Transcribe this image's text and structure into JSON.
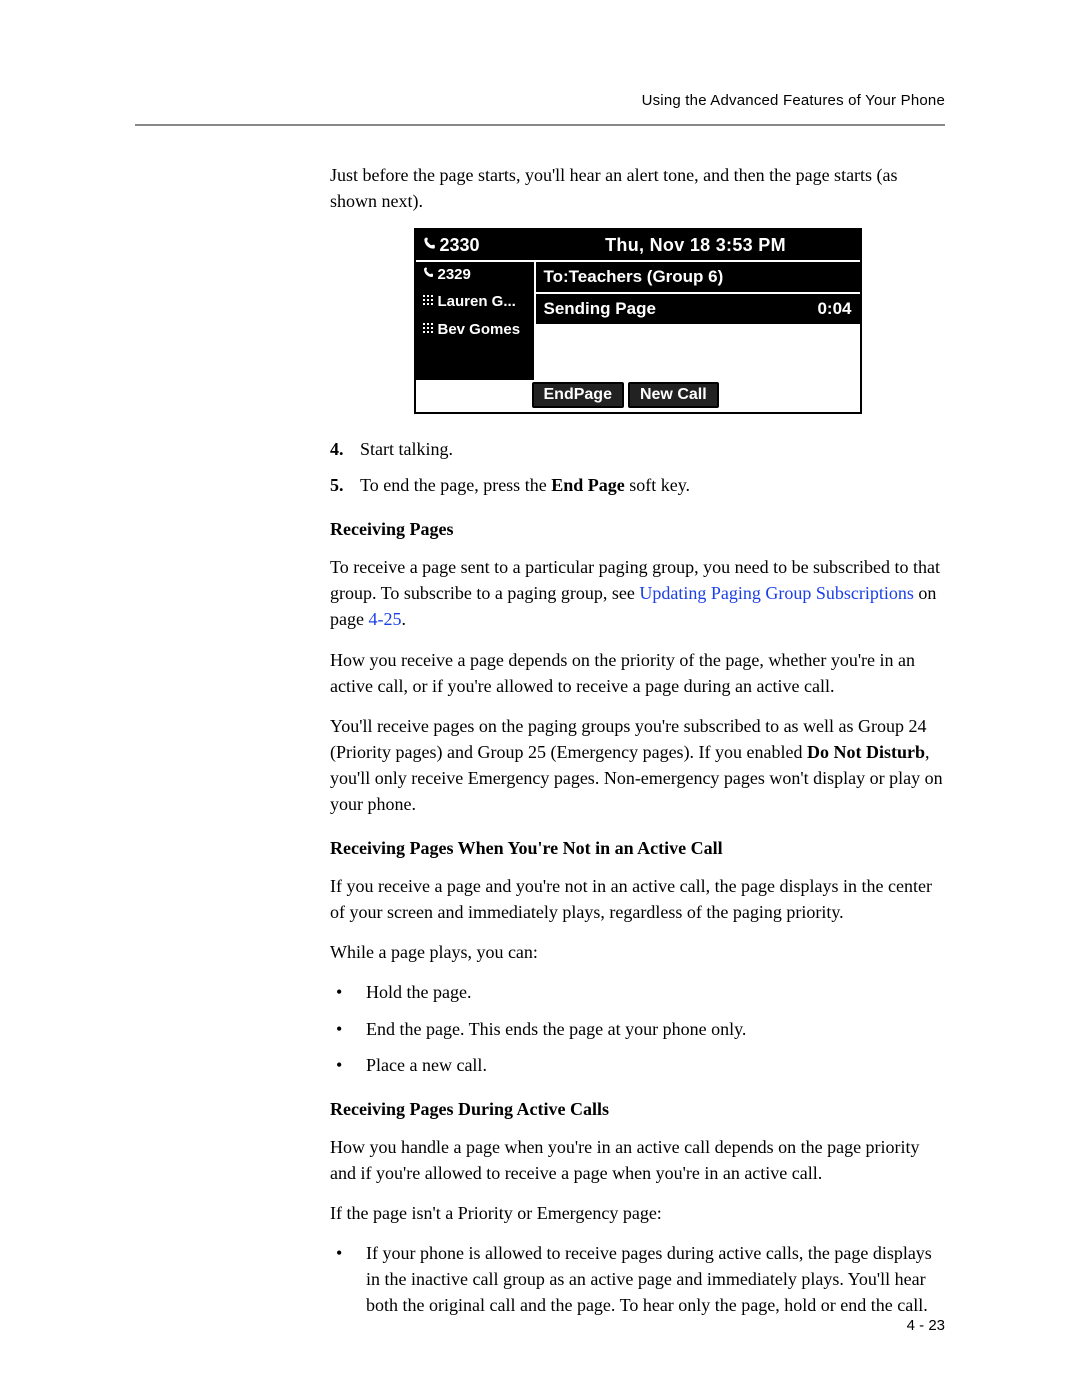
{
  "header": {
    "section_title": "Using the Advanced Features of Your Phone"
  },
  "intro": "Just before the page starts, you'll hear an alert tone, and then the page starts (as shown next).",
  "phone": {
    "ext_top": "2330",
    "datetime": "Thu, Nov 18  3:53 PM",
    "lines": [
      "2329",
      "Lauren G...",
      "Bev Gomes"
    ],
    "to": "To:Teachers (Group 6)",
    "status_label": "Sending Page",
    "status_time": "0:04",
    "softkeys": [
      "EndPage",
      "New Call"
    ]
  },
  "steps": {
    "s4": {
      "marker": "4.",
      "text": "Start talking."
    },
    "s5": {
      "marker": "5.",
      "pre": "To end the page, press the ",
      "bold": "End Page",
      "post": " soft key."
    }
  },
  "recv": {
    "heading": "Receiving Pages",
    "p1_pre": "To receive a page sent to a particular paging group, you need to be subscribed to that group. To subscribe to a paging group, see ",
    "p1_link": "Updating Paging Group Subscriptions",
    "p1_mid": " on page ",
    "p1_page": "4-25",
    "p1_post": ".",
    "p2": "How you receive a page depends on the priority of the page, whether you're in an active call, or if you're allowed to receive a page during an active call.",
    "p3_pre": "You'll receive pages on the paging groups you're subscribed to as well as Group 24 (Priority pages) and Group 25 (Emergency pages). If you enabled ",
    "p3_bold": "Do Not Disturb",
    "p3_post": ", you'll only receive Emergency pages. Non-emergency pages won't display or play on your phone."
  },
  "notactive": {
    "heading": "Receiving Pages When You're Not in an Active Call",
    "p1": "If you receive a page and you're not in an active call, the page displays in the center of your screen and immediately plays, regardless of the paging priority.",
    "p2": "While a page plays, you can:",
    "bullets": [
      "Hold the page.",
      "End the page. This ends the page at your phone only.",
      "Place a new call."
    ]
  },
  "active": {
    "heading": "Receiving Pages During Active Calls",
    "p1": "How you handle a page when you're in an active call depends on the page priority and if you're allowed to receive a page when you're in an active call.",
    "p2": "If the page isn't a Priority or Emergency page:",
    "bullet": "If your phone is allowed to receive pages during active calls, the page displays in the inactive call group as an active page and immediately plays. You'll hear both the original call and the page. To hear only the page, hold or end the call."
  },
  "footer": {
    "page_num": "4 - 23"
  }
}
